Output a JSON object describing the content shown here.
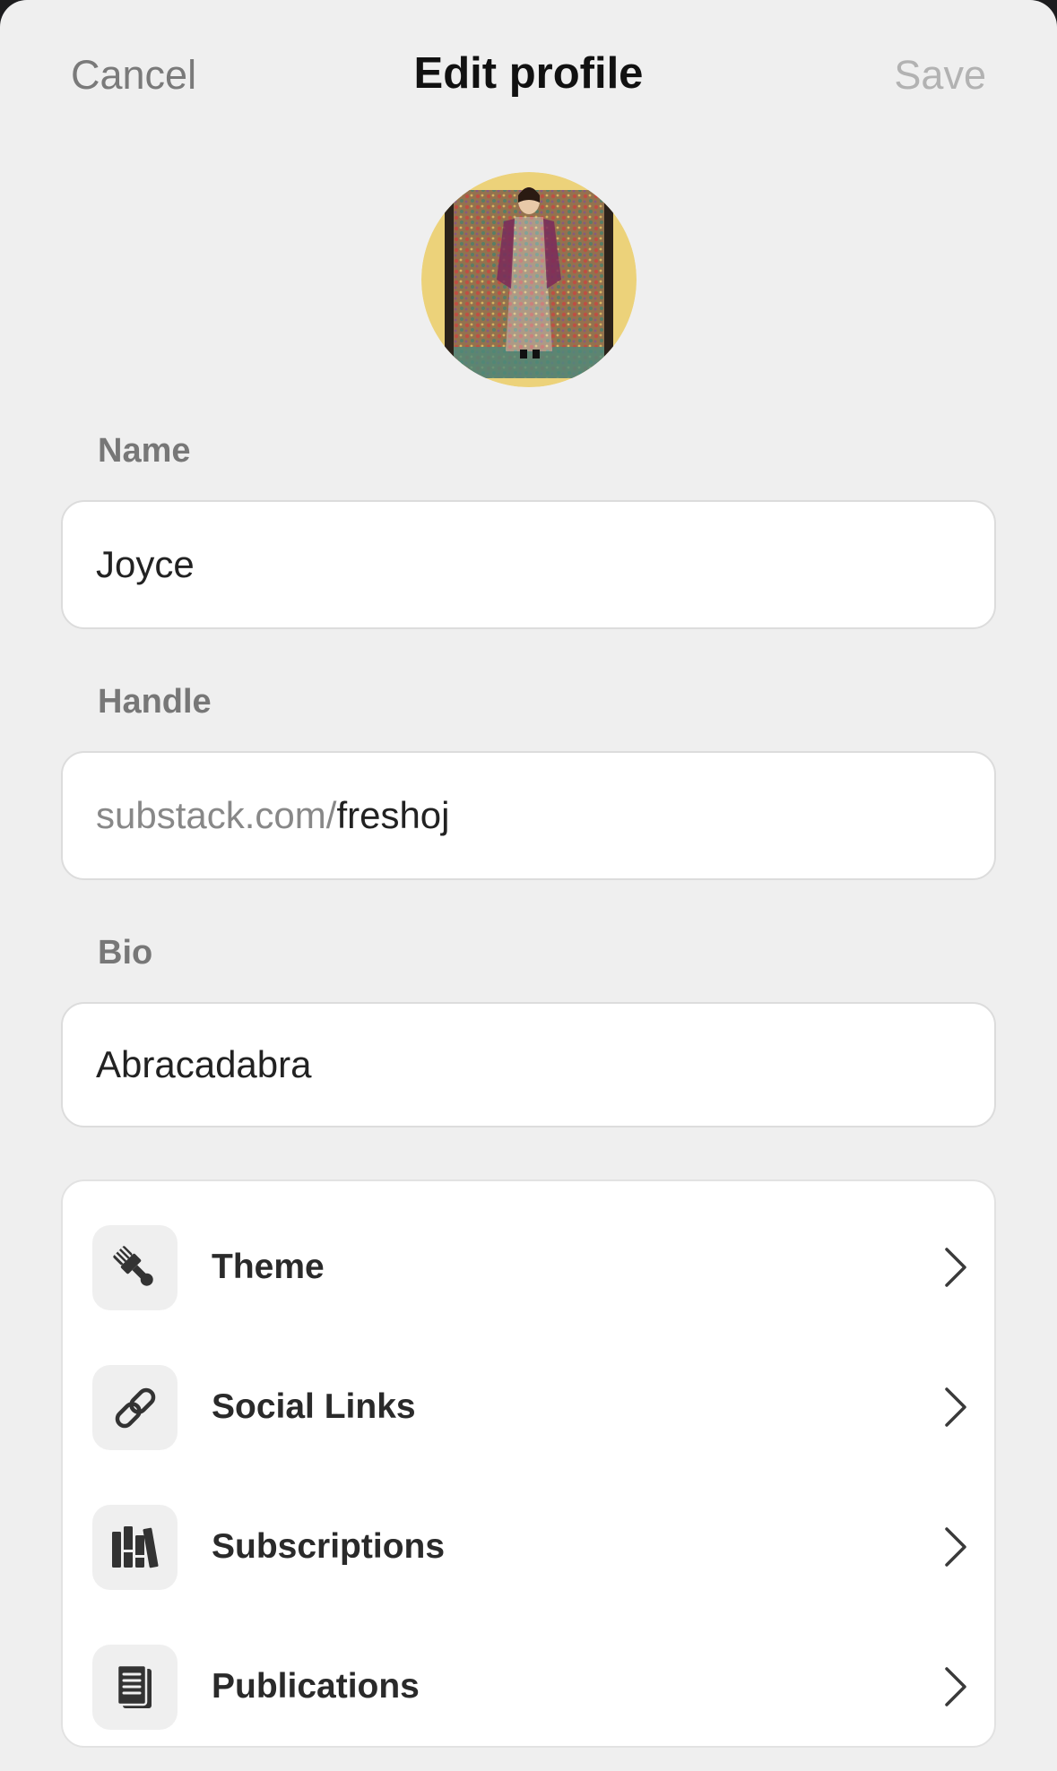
{
  "nav": {
    "cancel_label": "Cancel",
    "title": "Edit profile",
    "save_label": "Save"
  },
  "avatar": {
    "icon": "profile-photo"
  },
  "fields": {
    "name": {
      "label": "Name",
      "value": "Joyce"
    },
    "handle": {
      "label": "Handle",
      "prefix": "substack.com/",
      "value": "freshoj"
    },
    "bio": {
      "label": "Bio",
      "value": "Abracadabra"
    }
  },
  "menu": {
    "items": [
      {
        "label": "Theme",
        "icon": "paintbrush-icon"
      },
      {
        "label": "Social Links",
        "icon": "link-icon"
      },
      {
        "label": "Subscriptions",
        "icon": "books-icon"
      },
      {
        "label": "Publications",
        "icon": "document-icon"
      }
    ]
  },
  "colors": {
    "background": "#efefef",
    "card": "#ffffff",
    "title": "#111111",
    "muted": "#7a7a7a",
    "save_disabled": "#b2b2b2",
    "icon": "#333333"
  }
}
